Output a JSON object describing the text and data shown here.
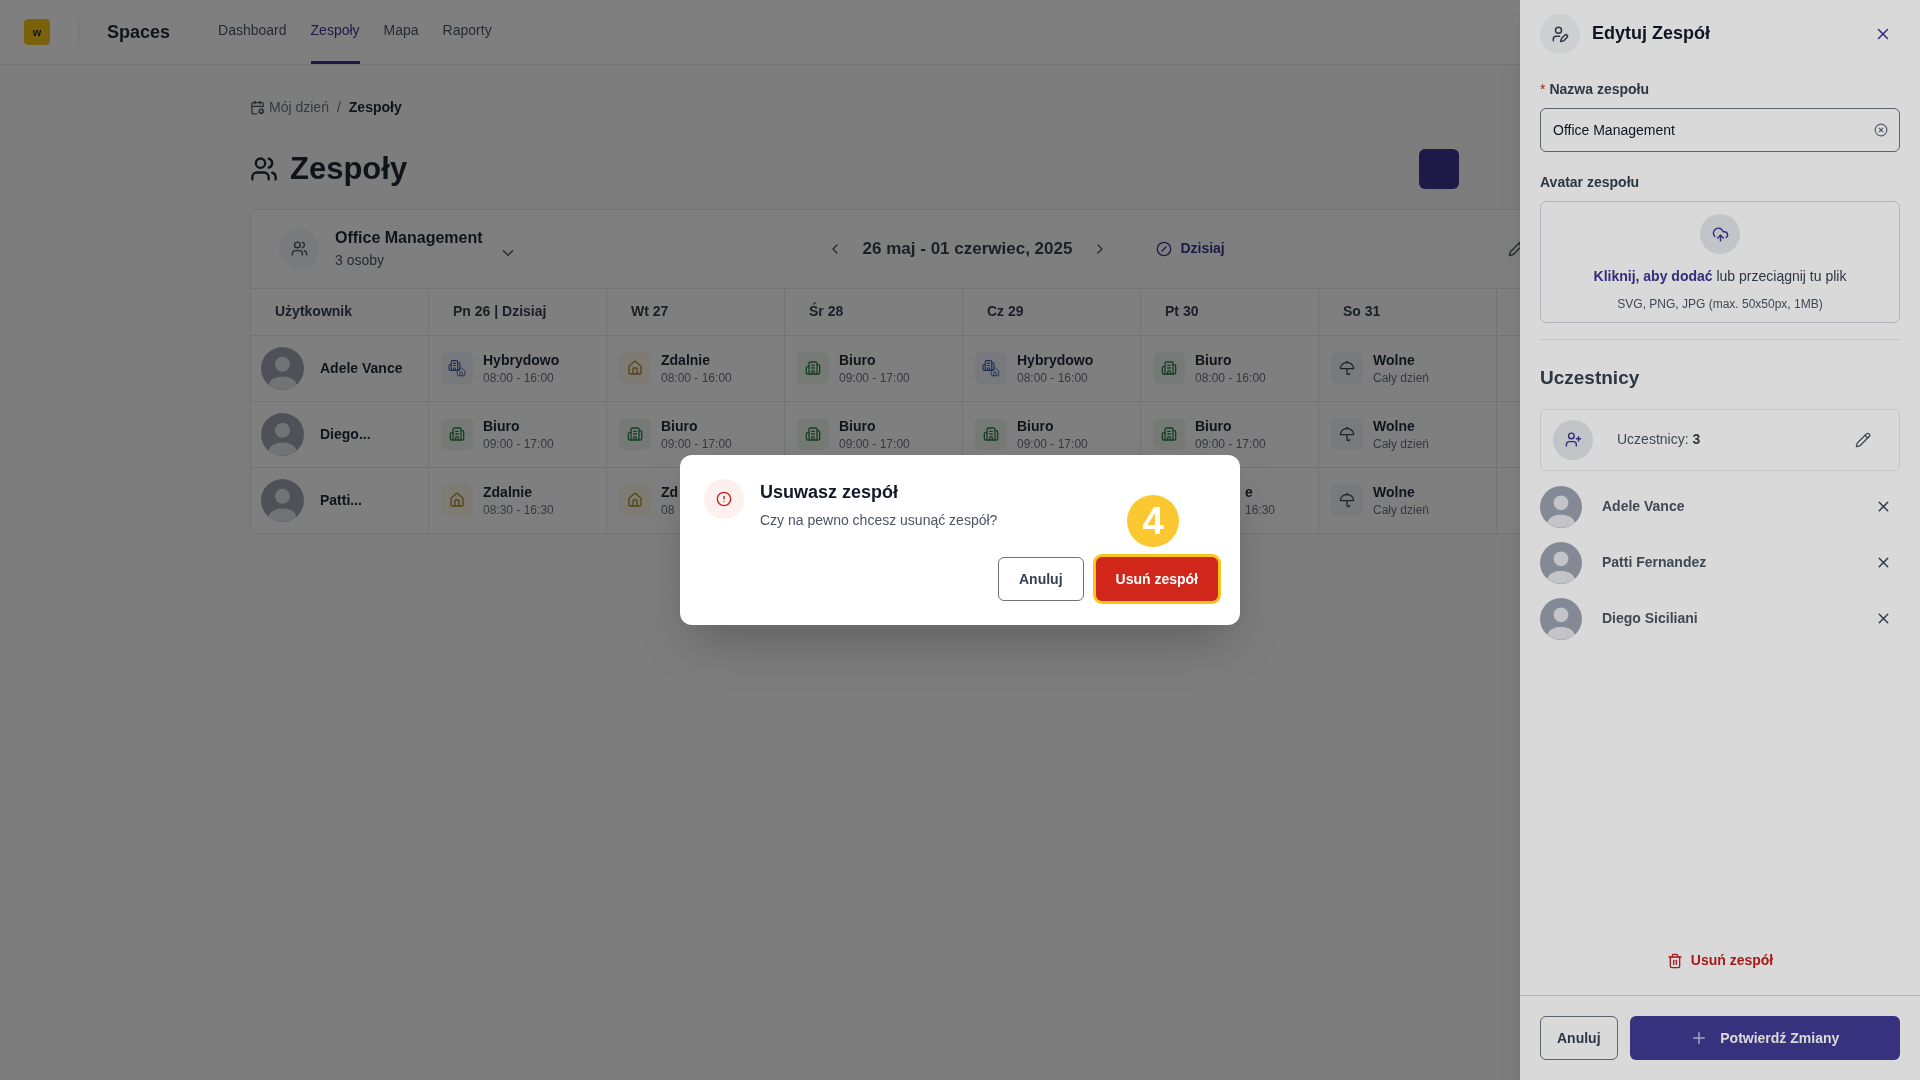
{
  "app": {
    "logo": "w",
    "name": "Spaces"
  },
  "nav": [
    {
      "label": "Dashboard",
      "selected": false
    },
    {
      "label": "Zespoły",
      "selected": true
    },
    {
      "label": "Mapa",
      "selected": false
    },
    {
      "label": "Raporty",
      "selected": false
    }
  ],
  "breadcrumb": {
    "items": [
      "Mój dzień",
      "Zespoły"
    ],
    "separator": "/"
  },
  "page_title": "Zespoły",
  "team_card": {
    "name": "Office Management",
    "members": "3 osoby",
    "date_range": "26 maj - 01 czerwiec, 2025",
    "today_button": "Dzisiaj"
  },
  "table": {
    "columns": [
      "Użytkownik",
      "Pn 26 | Dzisiaj",
      "Wt 27",
      "Śr 28",
      "Cz 29",
      "Pt 30",
      "So 31"
    ],
    "rows": [
      {
        "cells": [
          {
            "kind": "user",
            "status": "Adele Vance"
          },
          {
            "kind": "hybrid",
            "status": "Hybrydowo",
            "hours": "08:00 - 16:00"
          },
          {
            "kind": "remote",
            "status": "Zdalnie",
            "hours": "08:00 - 16:00"
          },
          {
            "kind": "office",
            "status": "Biuro",
            "hours": "09:00 - 17:00"
          },
          {
            "kind": "hybrid",
            "status": "Hybrydowo",
            "hours": "08:00 - 16:00"
          },
          {
            "kind": "office",
            "status": "Biuro",
            "hours": "08:00 - 16:00"
          },
          {
            "kind": "off",
            "status": "Wolne",
            "hours": "Cały dzień"
          }
        ]
      },
      {
        "cells": [
          {
            "kind": "user",
            "status": "Diego..."
          },
          {
            "kind": "office",
            "status": "Biuro",
            "hours": "09:00 - 17:00"
          },
          {
            "kind": "office",
            "status": "Biuro",
            "hours": "09:00 - 17:00"
          },
          {
            "kind": "office",
            "status": "Biuro",
            "hours": "09:00 - 17:00"
          },
          {
            "kind": "office",
            "status": "Biuro",
            "hours": "09:00 - 17:00"
          },
          {
            "kind": "office",
            "status": "Biuro",
            "hours": "09:00 - 17:00"
          },
          {
            "kind": "off",
            "status": "Wolne",
            "hours": "Cały dzień"
          }
        ]
      },
      {
        "cells": [
          {
            "kind": "user",
            "status": "Patti..."
          },
          {
            "kind": "remote",
            "status": "Zdalnie",
            "hours": "08:30 - 16:30"
          },
          {
            "kind": "remote",
            "status": "Zd",
            "hours": "08"
          },
          null,
          null,
          {
            "kind": "clipped",
            "status": "e",
            "hours": "16:30"
          },
          {
            "kind": "off",
            "status": "Wolne",
            "hours": "Cały dzień"
          }
        ]
      }
    ]
  },
  "modal": {
    "title": "Usuwasz zespół",
    "message": "Czy na pewno chcesz usunąć zespół?",
    "cancel": "Anuluj",
    "confirm": "Usuń zespół",
    "step_badge": "4"
  },
  "drawer": {
    "title": "Edytuj Zespół",
    "required_mark": "*",
    "name_label": "Nazwa zespołu",
    "name_value": "Office Management",
    "avatar_label": "Avatar zespołu",
    "upload_link": "Kliknij, aby dodać",
    "upload_text": "lub przeciągnij tu plik",
    "upload_hint": "SVG, PNG, JPG (max. 50x50px, 1MB)",
    "participants_heading": "Uczestnicy",
    "participants_label": "Uczestnicy:",
    "participants_count": "3",
    "members": [
      "Adele Vance",
      "Patti Fernandez",
      "Diego Siciliani"
    ],
    "delete": "Usuń zespół",
    "cancel": "Anuluj",
    "confirm": "Potwierdź Zmiany"
  }
}
